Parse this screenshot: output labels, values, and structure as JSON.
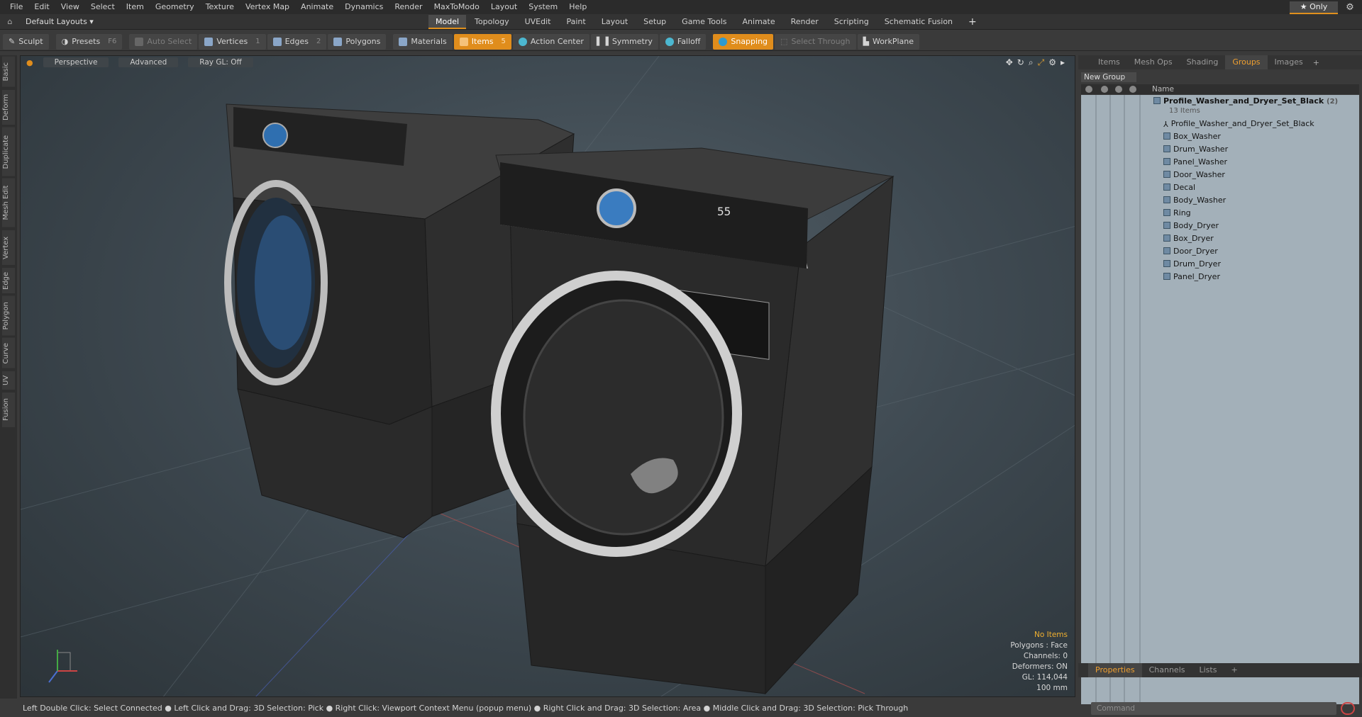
{
  "menu": [
    "File",
    "Edit",
    "View",
    "Select",
    "Item",
    "Geometry",
    "Texture",
    "Vertex Map",
    "Animate",
    "Dynamics",
    "Render",
    "MaxToModo",
    "Layout",
    "System",
    "Help"
  ],
  "layout_bar": {
    "layouts_label": "Default Layouts ▾",
    "tabs": [
      "Model",
      "Topology",
      "UVEdit",
      "Paint",
      "Layout",
      "Setup",
      "Game Tools",
      "Animate",
      "Render",
      "Scripting",
      "Schematic Fusion"
    ],
    "active_tab": "Model",
    "plus": "+",
    "only_label": "★  Only"
  },
  "toolbar": {
    "sculpt": "Sculpt",
    "presets": "Presets",
    "presets_key": "F6",
    "auto_select": "Auto Select",
    "vertices": "Vertices",
    "vertices_num": "1",
    "edges": "Edges",
    "edges_num": "2",
    "polygons": "Polygons",
    "materials": "Materials",
    "items": "Items",
    "items_num": "5",
    "action_center": "Action Center",
    "symmetry": "Symmetry",
    "falloff": "Falloff",
    "snapping": "Snapping",
    "select_through": "Select Through",
    "workplane": "WorkPlane"
  },
  "left_tabs": [
    "Basic",
    "Deform",
    "Duplicate",
    "Mesh Edit",
    "Vertex",
    "Edge",
    "Polygon",
    "Curve",
    "UV",
    "Fusion"
  ],
  "viewport": {
    "view": "Perspective",
    "mode": "Advanced",
    "raygl": "Ray GL: Off",
    "display_right": "55",
    "info": {
      "no_items": "No Items",
      "polygons": "Polygons : Face",
      "channels": "Channels: 0",
      "deformers": "Deformers: ON",
      "gl": "GL: 114,044",
      "scale": "100 mm"
    }
  },
  "right_panel": {
    "tabs": [
      "Items",
      "Mesh Ops",
      "Shading",
      "Groups",
      "Images"
    ],
    "active_tab": "Groups",
    "plus": "+",
    "new_group": "New Group",
    "name_header": "Name",
    "root_name": "Profile_Washer_and_Dryer_Set_Black",
    "root_count": "(2)",
    "root_items": "13 Items",
    "children": [
      "Profile_Washer_and_Dryer_Set_Black",
      "Box_Washer",
      "Drum_Washer",
      "Panel_Washer",
      "Door_Washer",
      "Decal",
      "Body_Washer",
      "Ring",
      "Body_Dryer",
      "Box_Dryer",
      "Door_Dryer",
      "Drum_Dryer",
      "Panel_Dryer"
    ],
    "bottom_tabs": [
      "Properties",
      "Channels",
      "Lists"
    ],
    "bottom_active": "Properties",
    "command_placeholder": "Command"
  },
  "status_bar": "Left Double Click: Select Connected ● Left Click and Drag: 3D Selection: Pick ● Right Click: Viewport Context Menu (popup menu) ● Right Click and Drag: 3D Selection: Area ● Middle Click and Drag: 3D Selection: Pick Through",
  "colors": {
    "accent": "#e08d1c",
    "list_bg": "#a3b0b9",
    "viewport_bg": "#3f4a52"
  }
}
